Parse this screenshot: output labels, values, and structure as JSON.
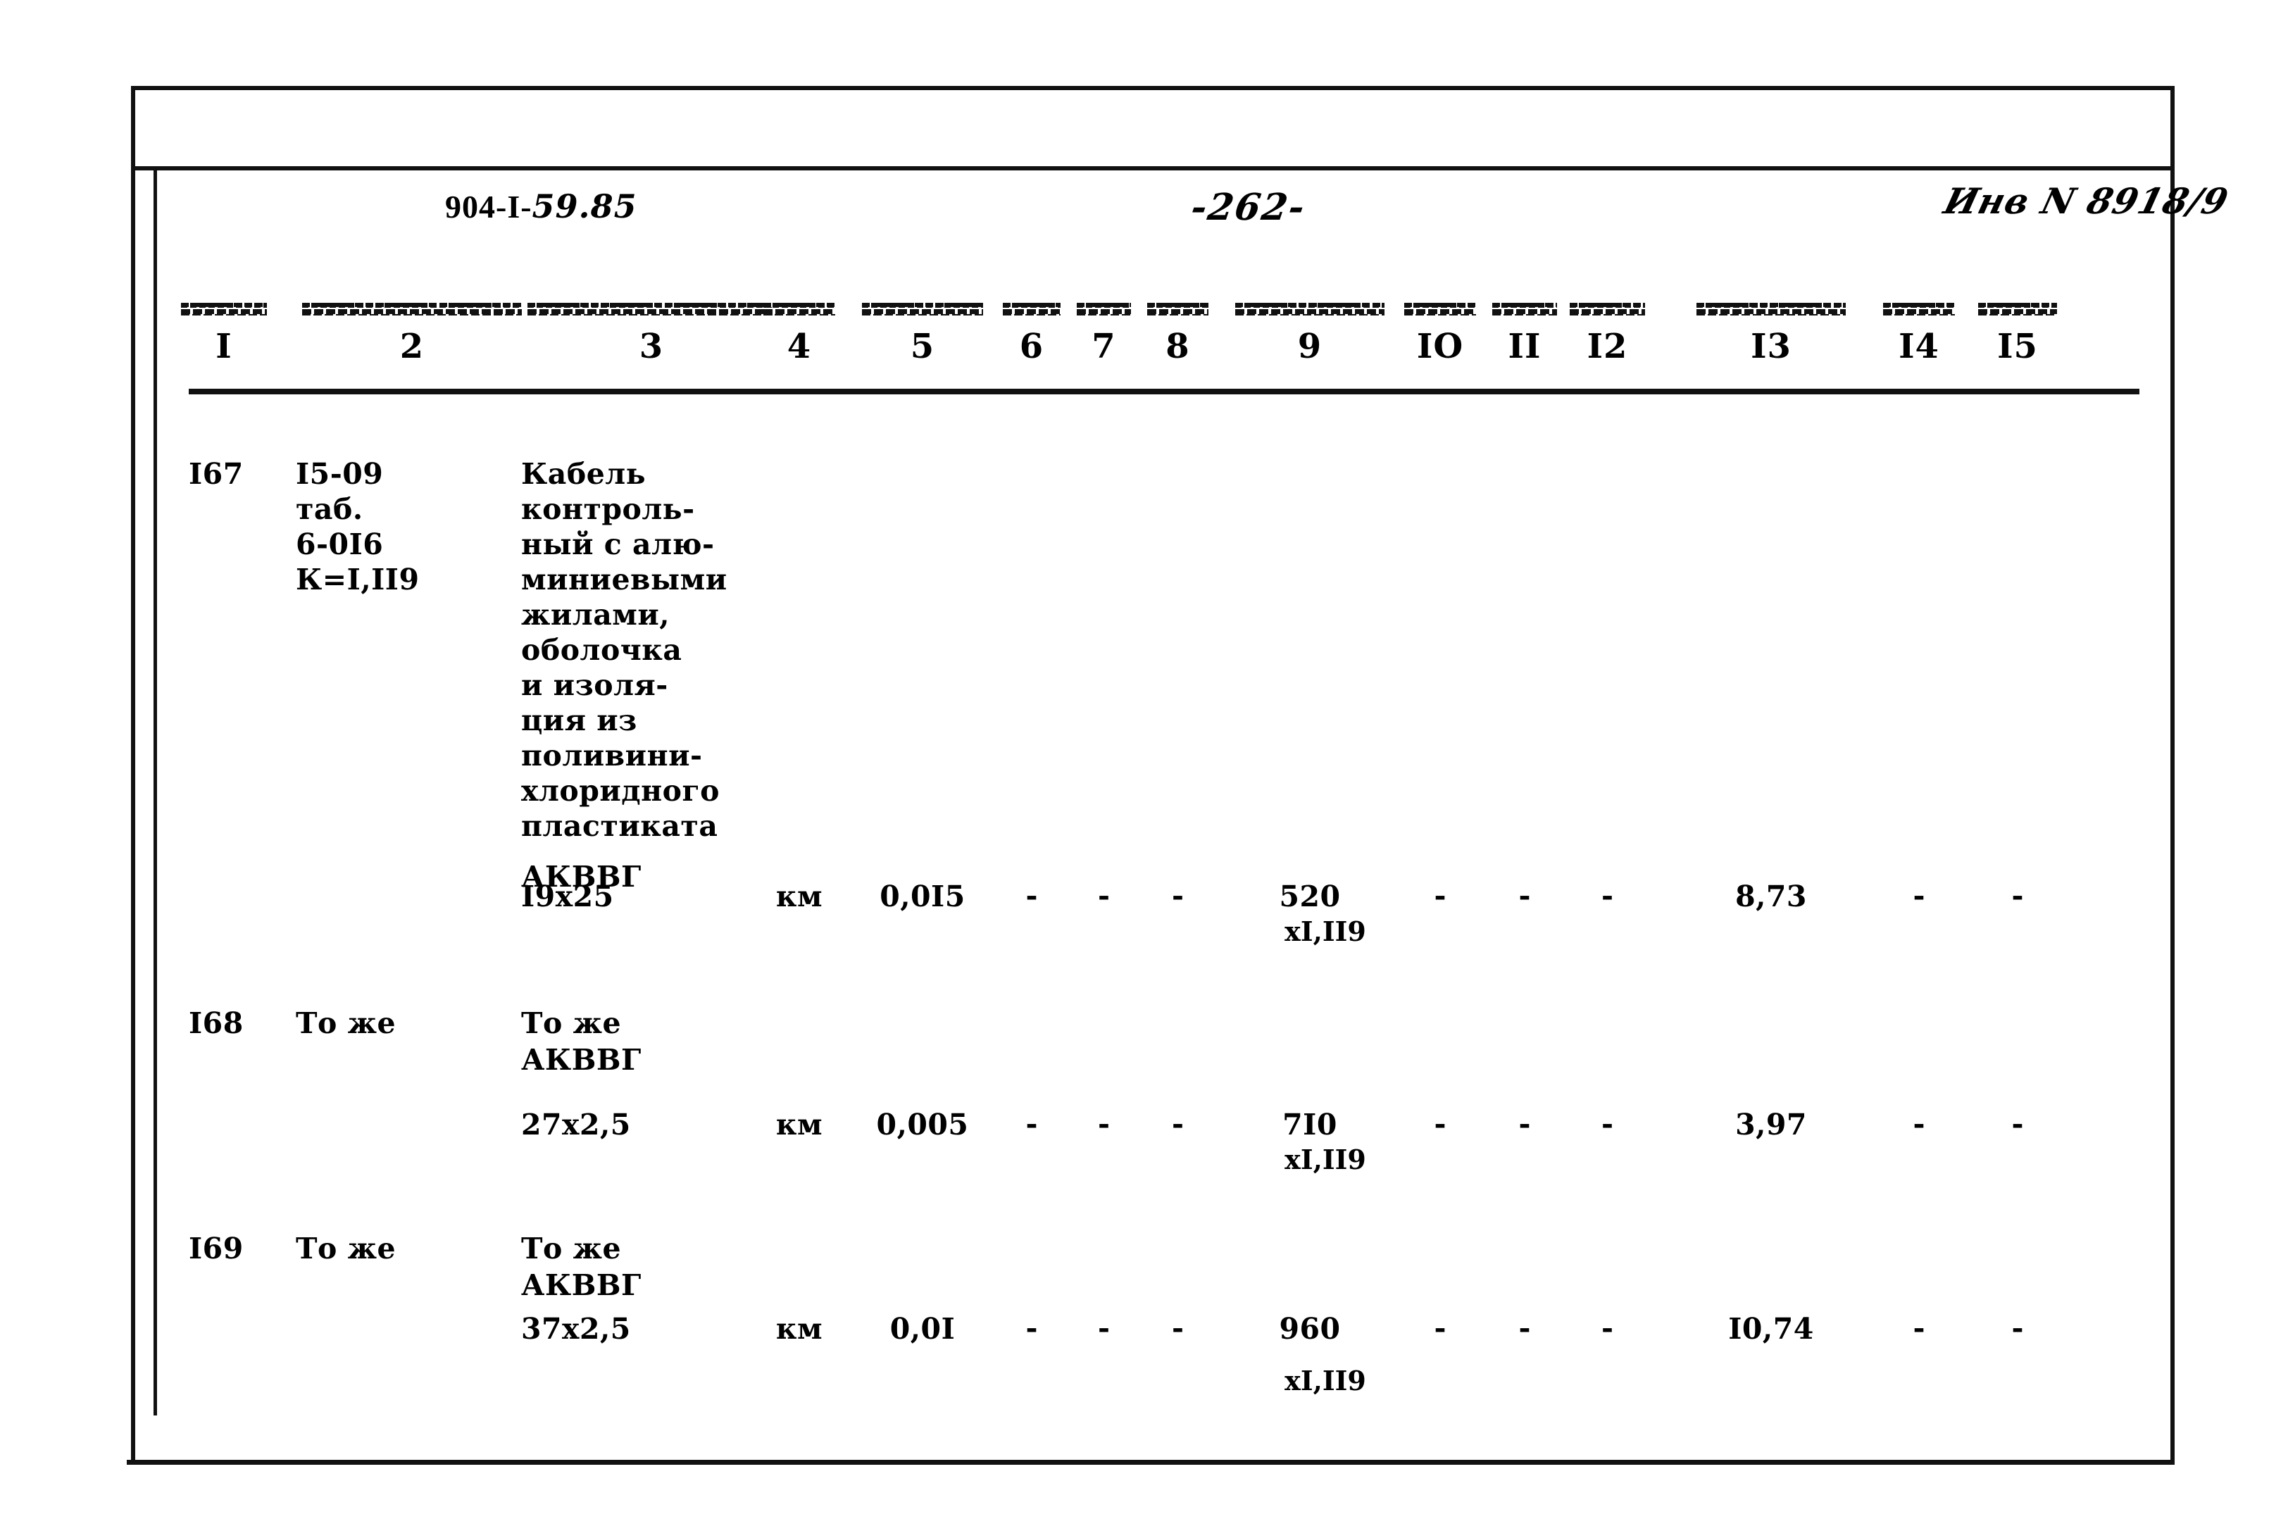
{
  "document": {
    "header": {
      "left_code": "904-I-",
      "left_revision": "59.85",
      "page_number": "-262-",
      "inventory_mark": "Инв N 8918/9"
    },
    "table": {
      "column_numbers": [
        "I",
        "2",
        "3",
        "4",
        "5",
        "6",
        "7",
        "8",
        "9",
        "IO",
        "II",
        "I2",
        "I3",
        "I4",
        "I5"
      ],
      "rows": [
        {
          "number": "I67",
          "code": "I5-09\nтаб.\n6-0I6\nК=I,II9",
          "description": "Кабель\nконтроль-\nный с алю-\nминиевыми\nжилами,\nоболочка\nи изоля-\nция из\nполивини-\nхлоридного\nпластиката",
          "brand": "АКВВГ",
          "size": "I9x25",
          "unit": "км",
          "qty": "0,0I5",
          "c6": "-",
          "c7": "-",
          "c8": "-",
          "c9": "520",
          "c9_sub": "xI,II9",
          "c10": "-",
          "c11": "-",
          "c12": "-",
          "c13": "8,73",
          "c14": "-",
          "c15": "-"
        },
        {
          "number": "I68",
          "code": "То же",
          "description": "То же",
          "brand": "АКВВГ",
          "size": "27x2,5",
          "unit": "км",
          "qty": "0,005",
          "c6": "-",
          "c7": "-",
          "c8": "-",
          "c9": "7I0",
          "c9_sub": "xI,II9",
          "c10": "-",
          "c11": "-",
          "c12": "-",
          "c13": "3,97",
          "c14": "-",
          "c15": "-"
        },
        {
          "number": "I69",
          "code": "То же",
          "description": "То же",
          "brand": "АКВВГ",
          "size": "37x2,5",
          "unit": "км",
          "qty": "0,0I",
          "c6": "-",
          "c7": "-",
          "c8": "-",
          "c9": "960",
          "c9_sub": "xI,II9",
          "c10": "-",
          "c11": "-",
          "c12": "-",
          "c13": "I0,74",
          "c14": "-",
          "c15": "-"
        }
      ]
    }
  }
}
